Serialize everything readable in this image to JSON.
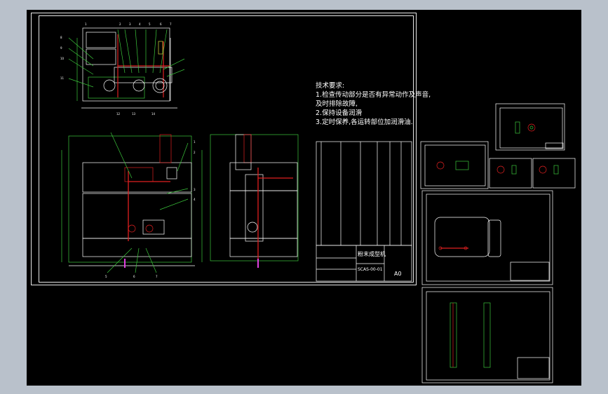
{
  "drawing": {
    "technical_requirements": {
      "heading": "技术要求:",
      "items": [
        "1.检查传动部分是否有异常动作及声音,",
        "及时排除故障,",
        "2.保持设备润滑",
        "3.定时保养,各运转部位加润滑油."
      ]
    },
    "title_block": {
      "name": "粉末成型机",
      "scale": "A0",
      "drawing_no": "SCAS-00-01"
    },
    "colors": {
      "background": "#000000",
      "outline": "#ffffff",
      "red": "#e02020",
      "green": "#3cc83c",
      "magenta": "#e040e0",
      "yellow": "#d8d840"
    }
  }
}
